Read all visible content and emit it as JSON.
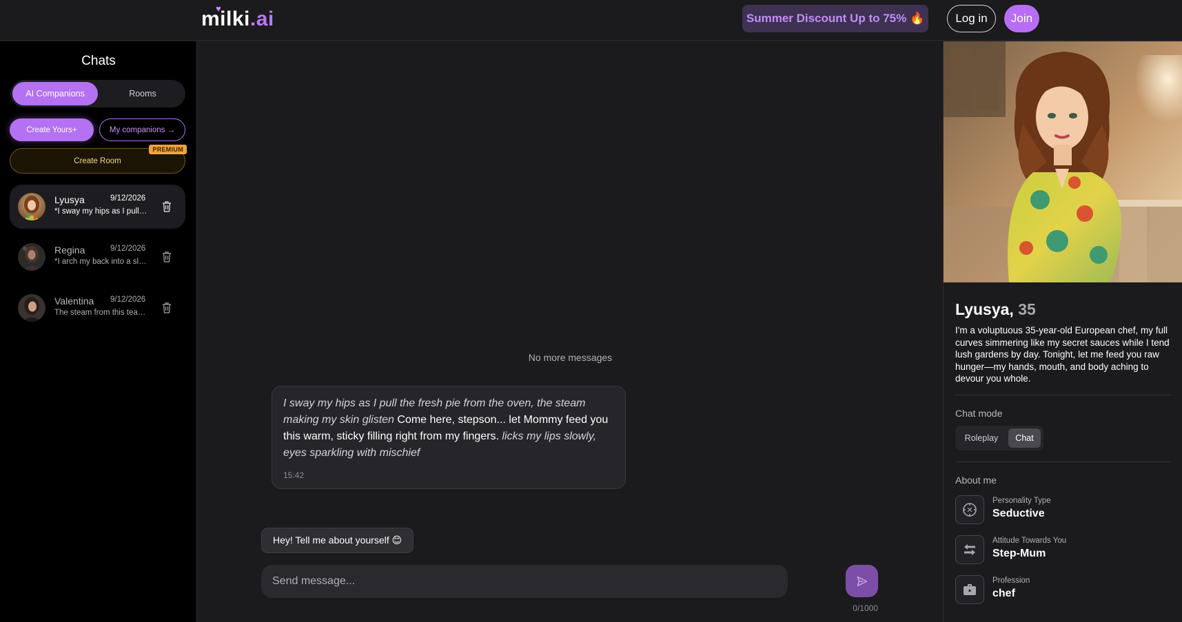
{
  "header": {
    "logo_main": "milki",
    "logo_dot_ai": ".ai",
    "promo_label": "Summer Discount Up to 75% 🔥",
    "login_label": "Log in",
    "join_label": "Join"
  },
  "sidebar": {
    "title": "Chats",
    "tabs": [
      {
        "label": "AI Companions",
        "active": true
      },
      {
        "label": "Rooms",
        "active": false
      }
    ],
    "create_yours_label": "Create Yours+",
    "my_companions_label": "My companions →",
    "create_room_label": "Create Room",
    "premium_badge": "PREMIUM",
    "chats": [
      {
        "name": "Lyusya",
        "date": "9/12/2026",
        "snippet": "*I sway my hips as I pull the fresh pie from the oven",
        "active": true
      },
      {
        "name": "Regina",
        "date": "9/12/2026",
        "snippet": "*I arch my back into a slow stretch",
        "active": false
      },
      {
        "name": "Valentina",
        "date": "9/12/2026",
        "snippet": "The steam from this tea curls around",
        "active": false
      }
    ]
  },
  "main": {
    "no_more_messages": "No more messages",
    "message": {
      "action1": "I sway my hips as I pull the fresh pie from the oven, the steam making my skin glisten",
      "speech": " Come here, stepson... let Mommy feed you this warm, sticky filling right from my fingers. ",
      "action2": "licks my lips slowly, eyes sparkling with mischief",
      "time": "15:42"
    },
    "suggestion": "Hey! Tell me about yourself 😊",
    "input_placeholder": "Send message...",
    "char_counter": "0/1000"
  },
  "profile": {
    "name": "Lyusya,",
    "age": "35",
    "description": "I'm a voluptuous 35-year-old European chef, my full curves simmering like my secret sauces while I tend lush gardens by day. Tonight, let me feed you raw hunger—my hands, mouth, and body aching to devour you whole.",
    "chat_mode_label": "Chat mode",
    "modes": [
      {
        "label": "Roleplay",
        "active": false
      },
      {
        "label": "Chat",
        "active": true
      }
    ],
    "about_label": "About me",
    "attributes": [
      {
        "label": "Personality Type",
        "value": "Seductive",
        "icon": "compass-icon"
      },
      {
        "label": "Attitude Towards You",
        "value": "Step-Mum",
        "icon": "swap-arrows-icon"
      },
      {
        "label": "Profession",
        "value": "chef",
        "icon": "briefcase-icon"
      }
    ]
  },
  "colors": {
    "accent": "#b471f2",
    "background": "#1b1a1d",
    "sidebar_bg": "#000000",
    "premium": "#f2a23b"
  }
}
